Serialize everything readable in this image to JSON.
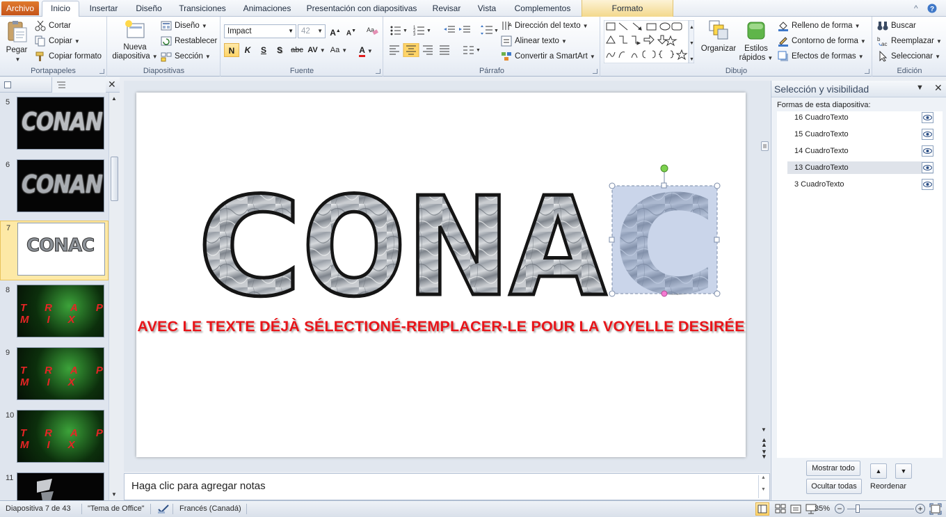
{
  "tabs": {
    "file": "Archivo",
    "items": [
      "Inicio",
      "Insertar",
      "Diseño",
      "Transiciones",
      "Animaciones",
      "Presentación con diapositivas",
      "Revisar",
      "Vista",
      "Complementos"
    ],
    "context": "Formato"
  },
  "ribbon": {
    "portapapeles": {
      "label": "Portapapeles",
      "paste": "Pegar",
      "cut": "Cortar",
      "copy": "Copiar",
      "format_painter": "Copiar formato"
    },
    "diapositivas": {
      "label": "Diapositivas",
      "new_slide_1": "Nueva",
      "new_slide_2": "diapositiva",
      "layout": "Diseño",
      "reset": "Restablecer",
      "section": "Sección"
    },
    "fuente": {
      "label": "Fuente",
      "font_name": "Impact",
      "font_size": "42",
      "bold": "N",
      "italic": "K",
      "underline": "S",
      "shadow": "S",
      "strike": "abc",
      "spacing": "AV",
      "case": "Aa",
      "color": "A"
    },
    "parrafo": {
      "label": "Párrafo",
      "text_direction": "Dirección del texto",
      "align_text": "Alinear texto",
      "smartart": "Convertir a SmartArt"
    },
    "dibujo": {
      "label": "Dibujo",
      "arrange": "Organizar",
      "quick_styles_1": "Estilos",
      "quick_styles_2": "rápidos",
      "fill": "Relleno de forma",
      "outline": "Contorno de forma",
      "effects": "Efectos de formas"
    },
    "edicion": {
      "label": "Edición",
      "find": "Buscar",
      "replace": "Reemplazar",
      "select": "Seleccionar"
    }
  },
  "thumbnails": [
    {
      "num": "5",
      "text": "CONAN",
      "theme": "dark"
    },
    {
      "num": "6",
      "text": "CONAN",
      "theme": "dark"
    },
    {
      "num": "7",
      "text": "CONAC",
      "theme": "light"
    },
    {
      "num": "8",
      "text": "TRAP MIX",
      "theme": "trap"
    },
    {
      "num": "9",
      "text": "TRAP MIX",
      "theme": "trap"
    },
    {
      "num": "10",
      "text": "TRAP MIX",
      "theme": "trap"
    },
    {
      "num": "11",
      "text": "",
      "theme": "dark"
    }
  ],
  "slide": {
    "letters": [
      "C",
      "O",
      "N",
      "A",
      "C"
    ],
    "instruction": "AVEC LE TEXTE DÉJÀ SÉLECTIONÉ-REMPLACER-LE POUR LA VOYELLE DESIRÉE",
    "instruction_color": "#e8151a"
  },
  "notes": {
    "placeholder": "Haga clic para agregar notas"
  },
  "selection_pane": {
    "title": "Selección y visibilidad",
    "subtitle": "Formas de esta diapositiva:",
    "shapes": [
      "16 CuadroTexto",
      "15 CuadroTexto",
      "14 CuadroTexto",
      "13 CuadroTexto",
      "3 CuadroTexto"
    ],
    "show_all": "Mostrar todo",
    "hide_all": "Ocultar todas",
    "reorder": "Reordenar"
  },
  "status": {
    "slide": "Diapositiva 7 de 43",
    "theme": "\"Tema de Office\"",
    "language": "Francés (Canadá)",
    "zoom": "35%"
  },
  "colors": {
    "accent": "#c5541a",
    "selection": "#fde9a6"
  }
}
